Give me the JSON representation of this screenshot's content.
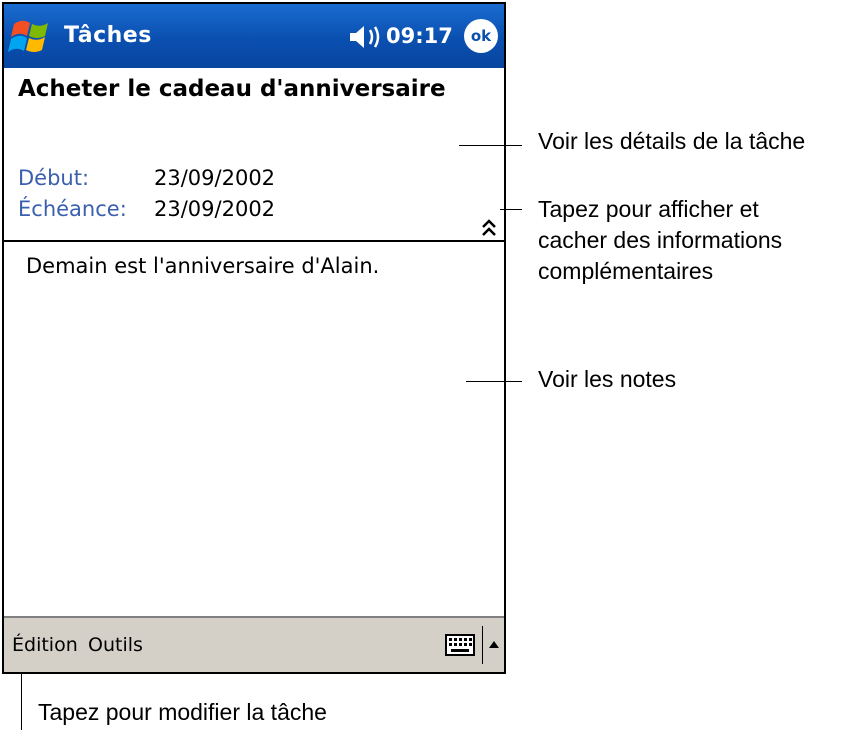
{
  "titlebar": {
    "app_title": "Tâches",
    "time": "09:17",
    "ok_label": "ok",
    "start_icon": "windows-flag-icon",
    "sound_icon": "speaker-icon"
  },
  "task": {
    "title": "Acheter le cadeau d'anniversaire",
    "start_label": "Début:",
    "start_value": "23/09/2002",
    "due_label": "Échéance:",
    "due_value": "23/09/2002",
    "notes": "Demain est l'anniversaire d'Alain."
  },
  "menubar": {
    "edit_label": "Édition",
    "tools_label": "Outils",
    "keyboard_icon": "keyboard-icon",
    "sip_icon": "up-arrow-icon"
  },
  "callouts": {
    "details": "Voir les détails de la tâche",
    "toggle_line1": "Tapez pour afficher et",
    "toggle_line2": "cacher des informations",
    "toggle_line3": "complémentaires",
    "notes": "Voir les notes",
    "edit": "Tapez pour modifier la tâche"
  },
  "colors": {
    "titlebar": "#0a4fb0",
    "label": "#3a5fae",
    "menubar": "#d4d0c8"
  }
}
